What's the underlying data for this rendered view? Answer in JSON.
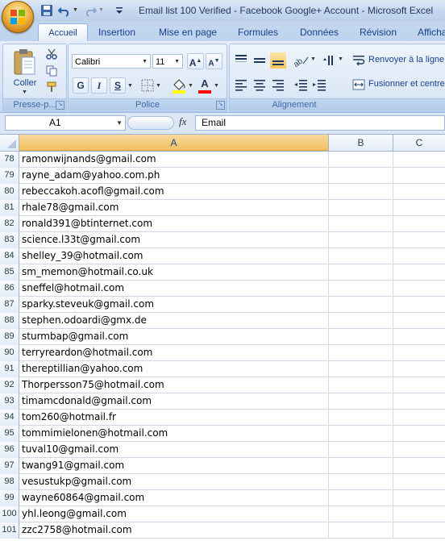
{
  "window": {
    "title": "Email list 100 Verified - Facebook Google+ Account - Microsoft Excel"
  },
  "tabs": [
    "Accueil",
    "Insertion",
    "Mise en page",
    "Formules",
    "Données",
    "Révision",
    "Affichage"
  ],
  "ribbon": {
    "clipboard": {
      "paste_label": "Coller",
      "group_label": "Presse-p..."
    },
    "font": {
      "name": "Calibri",
      "size": "11",
      "bold": "G",
      "italic": "I",
      "underline": "S",
      "grow": "A",
      "shrink": "A",
      "font_color_letter": "A",
      "group_label": "Police",
      "highlight_color": "#ffff00",
      "font_color": "#ff0000"
    },
    "alignment": {
      "wrap_label": "Renvoyer à la ligne",
      "merge_label": "Fusionner et centrer",
      "group_label": "Alignement"
    }
  },
  "formula_bar": {
    "name_box": "A1",
    "fx": "fx",
    "content": "Email"
  },
  "columns": [
    "A",
    "B",
    "C"
  ],
  "rows": [
    {
      "num": "78",
      "email": "ramonwijnands@gmail.com"
    },
    {
      "num": "79",
      "email": "rayne_adam@yahoo.com.ph"
    },
    {
      "num": "80",
      "email": "rebeccakoh.acofl@gmail.com"
    },
    {
      "num": "81",
      "email": "rhale78@gmail.com"
    },
    {
      "num": "82",
      "email": "ronald391@btinternet.com"
    },
    {
      "num": "83",
      "email": "science.l33t@gmail.com"
    },
    {
      "num": "84",
      "email": "shelley_39@hotmail.com"
    },
    {
      "num": "85",
      "email": "sm_memon@hotmail.co.uk"
    },
    {
      "num": "86",
      "email": "sneffel@hotmail.com"
    },
    {
      "num": "87",
      "email": "sparky.steveuk@gmail.com"
    },
    {
      "num": "88",
      "email": "stephen.odoardi@gmx.de"
    },
    {
      "num": "89",
      "email": "sturmbap@gmail.com"
    },
    {
      "num": "90",
      "email": "terryreardon@hotmail.com"
    },
    {
      "num": "91",
      "email": "thereptillian@yahoo.com"
    },
    {
      "num": "92",
      "email": "Thorpersson75@hotmail.com"
    },
    {
      "num": "93",
      "email": "timamcdonald@gmail.com"
    },
    {
      "num": "94",
      "email": "tom260@hotmail.fr"
    },
    {
      "num": "95",
      "email": "tommimielonen@hotmail.com"
    },
    {
      "num": "96",
      "email": "tuval10@gmail.com"
    },
    {
      "num": "97",
      "email": "twang91@gmail.com"
    },
    {
      "num": "98",
      "email": "vesustukp@gmail.com"
    },
    {
      "num": "99",
      "email": "wayne60864@gmail.com"
    },
    {
      "num": "100",
      "email": "yhl.leong@gmail.com"
    },
    {
      "num": "101",
      "email": "zzc2758@hotmail.com"
    }
  ],
  "icons": [
    "office-button-icon",
    "save-icon",
    "undo-icon",
    "redo-icon",
    "qat-customize-icon",
    "paste-icon",
    "cut-icon",
    "copy-icon",
    "format-painter-icon",
    "borders-icon",
    "fill-color-icon",
    "font-color-icon",
    "wrap-text-icon",
    "merge-center-icon"
  ]
}
